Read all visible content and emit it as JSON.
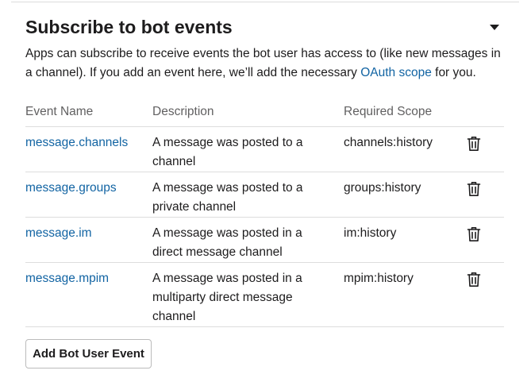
{
  "section": {
    "title": "Subscribe to bot events",
    "toggle_icon": "caret-down-icon"
  },
  "intro": {
    "text_before": "Apps can subscribe to receive events the bot user has access to (like new messages in a channel). If you add an event here, we’ll add the necessary ",
    "link": "OAuth scope",
    "text_after": " for you."
  },
  "table": {
    "headers": {
      "name": "Event Name",
      "description": "Description",
      "scope": "Required Scope"
    },
    "rows": [
      {
        "name": "message.channels",
        "description": "A message was posted to a channel",
        "scope": "channels:history",
        "action_icon": "trash-icon"
      },
      {
        "name": "message.groups",
        "description": "A message was posted to a private channel",
        "scope": "groups:history",
        "action_icon": "trash-icon"
      },
      {
        "name": "message.im",
        "description": "A message was posted in a direct message channel",
        "scope": "im:history",
        "action_icon": "trash-icon"
      },
      {
        "name": "message.mpim",
        "description": "A message was posted in a multiparty direct message channel",
        "scope": "mpim:history",
        "action_icon": "trash-icon"
      }
    ]
  },
  "add_button": {
    "label": "Add Bot User Event"
  },
  "colors": {
    "link": "#1264a3",
    "text": "#1d1c1d",
    "muted": "#616061",
    "divider": "#dddddd"
  }
}
